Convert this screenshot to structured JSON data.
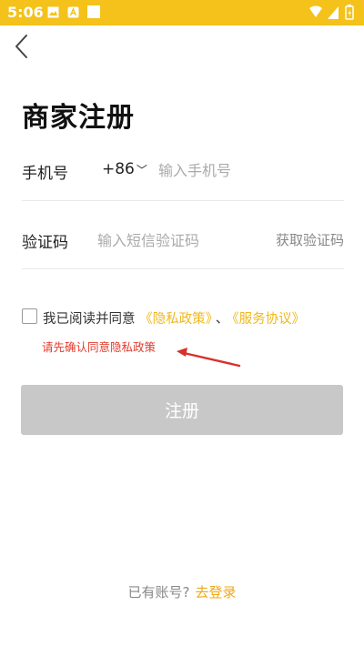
{
  "status_bar": {
    "time": "5:06"
  },
  "page": {
    "title": "商家注册"
  },
  "phone": {
    "label": "手机号",
    "country_code": "+86",
    "placeholder": "输入手机号"
  },
  "code": {
    "label": "验证码",
    "placeholder": "输入短信验证码",
    "get_code": "获取验证码"
  },
  "agreement": {
    "prefix": "我已阅读并同意",
    "privacy": "《隐私政策》",
    "separator": "、",
    "service": "《服务协议》",
    "checked": false
  },
  "error": {
    "message": "请先确认同意隐私政策"
  },
  "register_button": {
    "label": "注册"
  },
  "footer": {
    "have_account": "已有账号?",
    "login": "去登录"
  },
  "colors": {
    "status_bar": "#F4C21A",
    "link": "#F0B81C",
    "error": "#E23B2E",
    "button_disabled": "#C8C8C8"
  }
}
